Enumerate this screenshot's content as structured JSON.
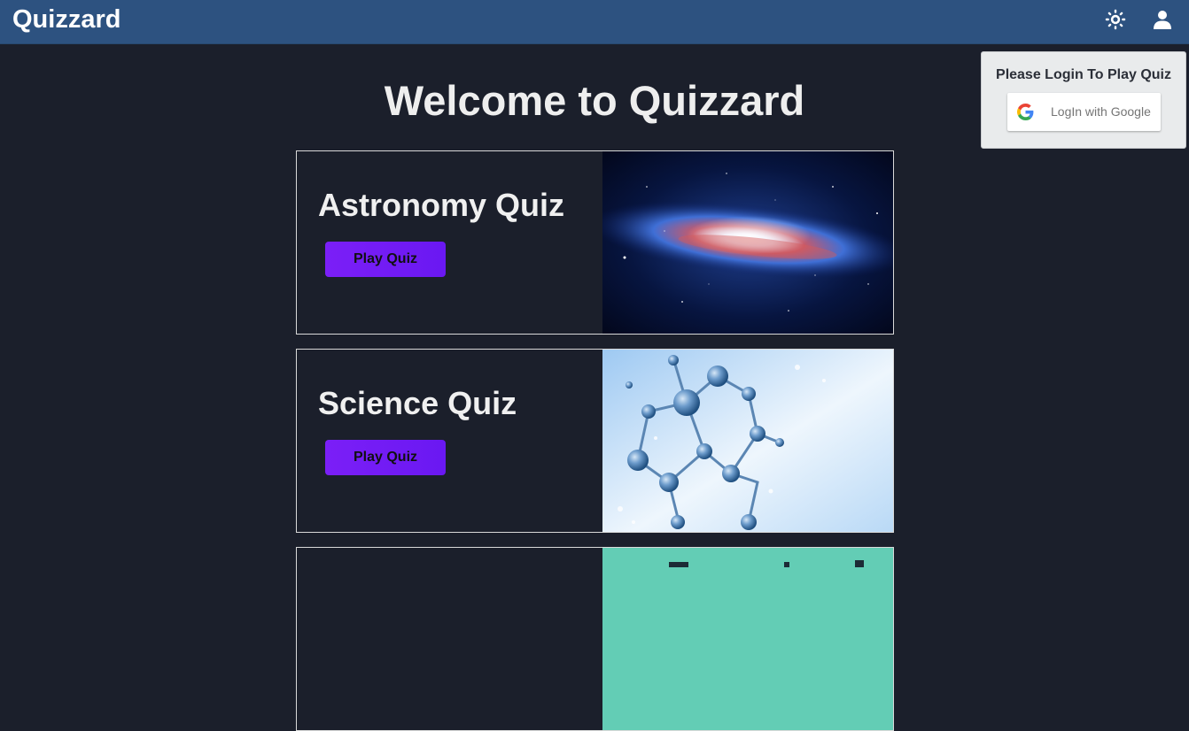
{
  "header": {
    "brand": "Quizzard",
    "theme_icon": "sun-icon",
    "user_icon": "user-icon"
  },
  "login": {
    "title": "Please Login To Play Quiz",
    "google_label": "LogIn with Google",
    "google_icon": "google-logo-icon"
  },
  "main": {
    "title": "Welcome to Quizzard",
    "quizzes": [
      {
        "name": "Astronomy Quiz",
        "button": "Play Quiz",
        "image": "galaxy-image"
      },
      {
        "name": "Science Quiz",
        "button": "Play Quiz",
        "image": "molecules-image"
      },
      {
        "name": "",
        "button": "",
        "image": "teal-image"
      }
    ]
  },
  "colors": {
    "header_bg": "#2d5280",
    "page_bg": "#1b1f2b",
    "button": "#7b1ff7",
    "popover_bg": "#e9ebec"
  }
}
